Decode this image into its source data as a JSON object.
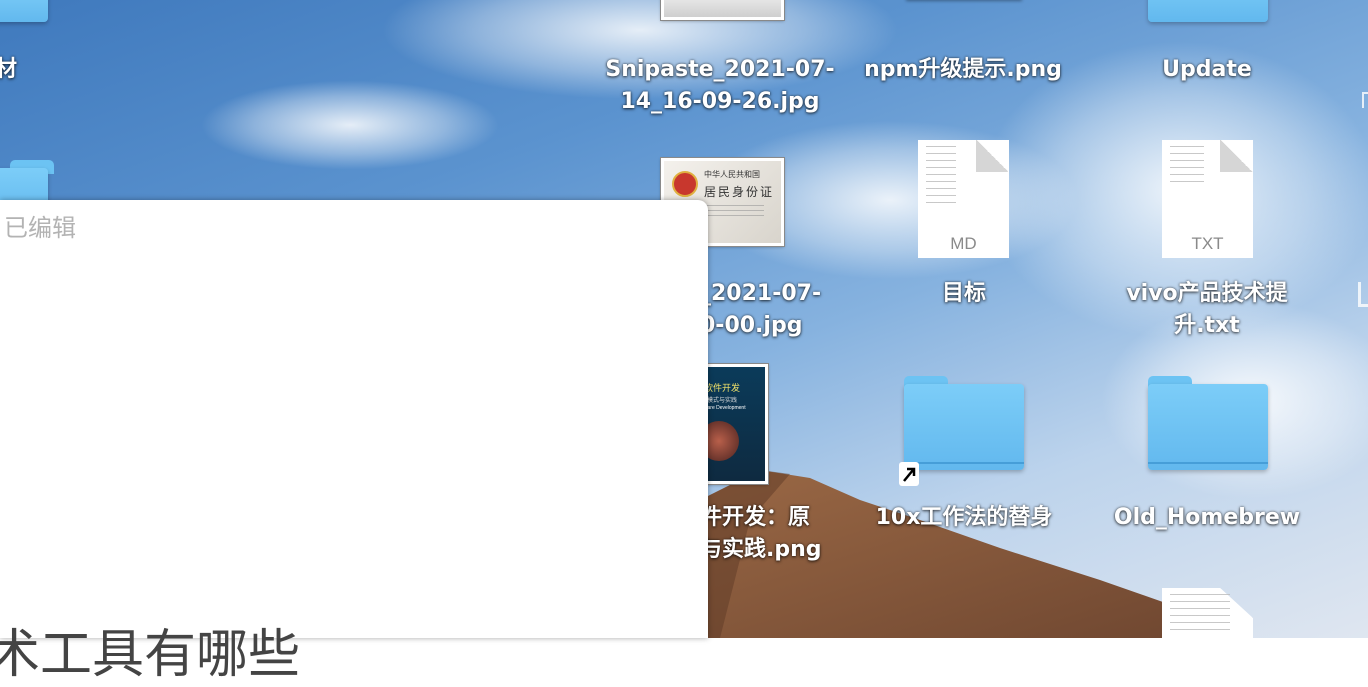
{
  "desktop": {
    "icons": [
      {
        "label": "Snipaste_2021-07-\n14_16-09-26.jpg",
        "type": "image"
      },
      {
        "label": "npm升级提示.png",
        "type": "image"
      },
      {
        "label": "Update",
        "type": "folder"
      },
      {
        "label": "_2021-07-\n0-00.jpg",
        "type": "image"
      },
      {
        "label": "目标",
        "type": "document",
        "ext": "MD"
      },
      {
        "label": "vivo产品技术提\n升.txt",
        "type": "document",
        "ext": "TXT"
      },
      {
        "label": "件开发：原\n与实践.png",
        "type": "image"
      },
      {
        "label": "10x工作法的替身",
        "type": "folder-alias"
      },
      {
        "label": "Old_Homebrew",
        "type": "folder"
      },
      {
        "label": "材",
        "type": "folder"
      }
    ],
    "id_card_text": {
      "line1": "中华人民共和国",
      "line2": "居民身份证"
    },
    "book_cover_text": {
      "title": "件软件开发",
      "sub": "原、模式与实践",
      "en": "Software Development"
    }
  },
  "window": {
    "status": "已编辑",
    "heading": "术工具有哪些"
  },
  "colors": {
    "folder": "#7ccdf8",
    "sky": "#5b93cf",
    "dune": "#8a5a3a"
  }
}
